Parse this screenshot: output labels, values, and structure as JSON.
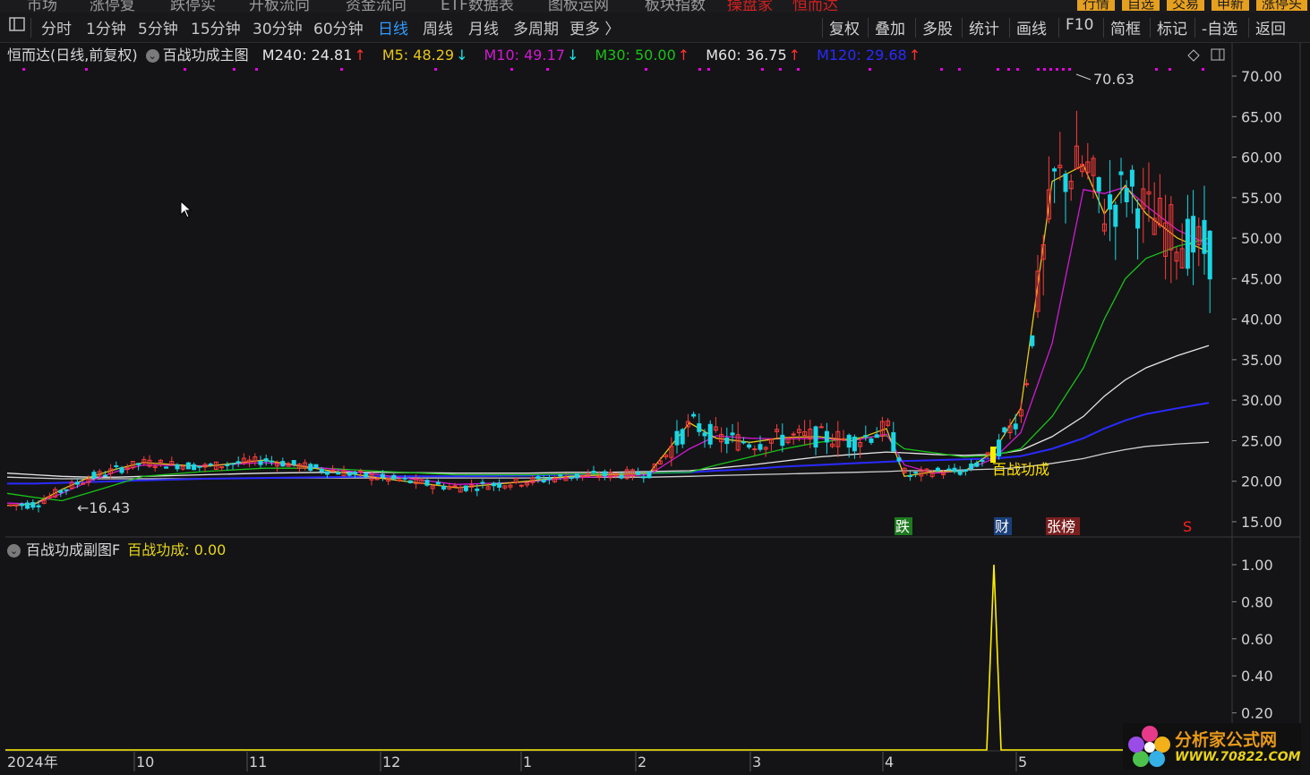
{
  "top_menu": {
    "items": [
      "市场",
      "涨停复",
      "跌停实",
      "开板流向",
      "资金流向",
      "ETF数据表",
      "图板运网",
      "板块指数"
    ],
    "red_items": [
      "操盘家",
      "恒而达"
    ],
    "right_tags": [
      {
        "label": "行情",
        "color": "#e6a020"
      },
      {
        "label": "自选",
        "color": "#e6a020"
      },
      {
        "label": "交易",
        "color": "#e6a020"
      },
      {
        "label": "申新",
        "color": "#e6a020"
      },
      {
        "label": "涨停头",
        "color": "#e6a020"
      }
    ]
  },
  "toolbar": {
    "periods": [
      "分时",
      "1分钟",
      "5分钟",
      "15分钟",
      "30分钟",
      "60分钟",
      "日线",
      "周线",
      "月线",
      "多周期",
      "更多 〉"
    ],
    "active_period": "日线",
    "right_buttons": [
      "复权",
      "叠加",
      "多股",
      "统计",
      "画线",
      "F10",
      "简框",
      "标记",
      "-自选",
      "返回"
    ]
  },
  "main_legend": {
    "title": "恒而达(日线,前复权)",
    "indicator_name": "百战功成主图",
    "ma_items": [
      {
        "label": "M240: 24.81",
        "arrow": "↑",
        "color": "#e6e6e6",
        "arrow_color": "#ff3030"
      },
      {
        "label": "M5: 48.29",
        "arrow": "↓",
        "color": "#e6c619",
        "arrow_color": "#19e6e6"
      },
      {
        "label": "M10: 49.17",
        "arrow": "↓",
        "color": "#d219d2",
        "arrow_color": "#19e6e6"
      },
      {
        "label": "M30: 50.00",
        "arrow": "↑",
        "color": "#19c219",
        "arrow_color": "#ff3030"
      },
      {
        "label": "M60: 36.75",
        "arrow": "↑",
        "color": "#e6e6e6",
        "arrow_color": "#ff3030"
      },
      {
        "label": "M120: 29.68",
        "arrow": "↑",
        "color": "#2a2aff",
        "arrow_color": "#ff3030"
      }
    ]
  },
  "sub_legend": {
    "indicator_name": "百战功成副图F",
    "value_label": "百战功成: 0.00",
    "value_color": "#e6d619"
  },
  "y_axis_main": [
    "70.00",
    "65.00",
    "60.00",
    "55.00",
    "50.00",
    "45.00",
    "40.00",
    "35.00",
    "30.00",
    "25.00",
    "20.00",
    "15.00"
  ],
  "y_axis_sub": [
    "1.00",
    "0.80",
    "0.60",
    "0.40",
    "0.20"
  ],
  "x_axis": [
    "2024年",
    "10",
    "11",
    "12",
    "1",
    "2",
    "3",
    "4",
    "5"
  ],
  "annotations": {
    "high_label": "70.63",
    "low_label": "16.43",
    "signal_text": "百战功成",
    "markers": [
      {
        "text": "跌",
        "bg": "#1f7a1f",
        "color": "#ffffff"
      },
      {
        "text": "财",
        "bg": "#1a3f7a",
        "color": "#ffffff"
      },
      {
        "text": "张榜",
        "bg": "#7a1f1f",
        "color": "#ffffff"
      },
      {
        "text": "S",
        "bg": "",
        "color": "#ff2020"
      }
    ]
  },
  "watermark": {
    "line1": "分析家公式网",
    "line2": "WWW.70822.COM"
  },
  "chart_data": {
    "type": "line",
    "title": "",
    "x_ticks": [
      "2024年",
      "10",
      "11",
      "12",
      "1",
      "2",
      "3",
      "4",
      "5"
    ],
    "ylim_main": [
      15,
      72
    ],
    "ylim_sub": [
      0,
      1.05
    ],
    "series": [
      {
        "name": "M5",
        "color": "#e6c619",
        "values": [
          17.0,
          17.2,
          19.0,
          20.5,
          21.5,
          22.3,
          21.8,
          22.6,
          21.4,
          20.3,
          19.2,
          20.0,
          20.6,
          20.8,
          21.0,
          27.2,
          25.3,
          24.8,
          25.4,
          25.5,
          25.0,
          26.5,
          20.6,
          21.2,
          21.2,
          23.7,
          29.0,
          57.0,
          59.0,
          53.0,
          56.5,
          53.0,
          50.0,
          48.3
        ]
      },
      {
        "name": "M10",
        "color": "#d219d2",
        "values": [
          17.3,
          17.2,
          18.5,
          20.0,
          21.2,
          22.0,
          21.9,
          22.3,
          21.6,
          20.7,
          19.6,
          19.9,
          20.4,
          20.6,
          20.8,
          24.0,
          25.6,
          25.3,
          25.2,
          25.3,
          25.0,
          25.8,
          22.0,
          21.0,
          21.3,
          22.8,
          26.0,
          37.0,
          56.0,
          55.5,
          56.3,
          54.0,
          51.0,
          49.2
        ]
      },
      {
        "name": "M30",
        "color": "#19c219",
        "values": [
          18.5,
          18.0,
          17.6,
          18.6,
          19.6,
          20.6,
          21.2,
          21.6,
          21.6,
          21.2,
          20.8,
          20.8,
          20.9,
          20.9,
          21.0,
          21.1,
          22.0,
          23.0,
          24.0,
          24.8,
          25.3,
          25.6,
          24.0,
          23.5,
          23.0,
          23.2,
          24.0,
          28.0,
          34.0,
          40.0,
          45.0,
          47.5,
          49.0,
          50.0
        ]
      },
      {
        "name": "M60",
        "color": "#e6e6e6",
        "values": [
          21.0,
          20.8,
          20.6,
          20.5,
          20.5,
          20.6,
          20.8,
          21.0,
          21.1,
          21.1,
          21.0,
          21.0,
          21.1,
          21.1,
          21.2,
          21.3,
          21.6,
          22.0,
          22.5,
          23.0,
          23.3,
          23.6,
          23.5,
          23.3,
          23.2,
          23.3,
          23.8,
          25.5,
          28.0,
          30.5,
          32.5,
          34.0,
          35.5,
          36.75
        ]
      },
      {
        "name": "M120",
        "color": "#2a2aff",
        "values": [
          19.7,
          19.7,
          19.8,
          19.9,
          20.0,
          20.1,
          20.3,
          20.4,
          20.5,
          20.6,
          20.6,
          20.7,
          20.8,
          20.9,
          21.0,
          21.1,
          21.3,
          21.5,
          21.8,
          22.0,
          22.2,
          22.4,
          22.5,
          22.6,
          22.7,
          22.8,
          23.1,
          24.0,
          25.3,
          26.5,
          27.5,
          28.3,
          29.0,
          29.68
        ]
      },
      {
        "name": "M240",
        "color": "#d0d0d0",
        "values": [
          20.5,
          20.4,
          20.3,
          20.3,
          20.3,
          20.3,
          20.3,
          20.4,
          20.4,
          20.4,
          20.4,
          20.4,
          20.5,
          20.5,
          20.5,
          20.6,
          20.7,
          20.8,
          20.9,
          21.0,
          21.1,
          21.2,
          21.3,
          21.3,
          21.4,
          21.5,
          21.7,
          22.2,
          22.8,
          23.4,
          23.9,
          24.3,
          24.6,
          24.81
        ]
      }
    ],
    "sub_series": {
      "name": "百战功成",
      "values": [
        0,
        0,
        0,
        0,
        0,
        0,
        0,
        0,
        0,
        0,
        0,
        0,
        0,
        0,
        0,
        0,
        0,
        0,
        0,
        0,
        0,
        0,
        0,
        0,
        0,
        1.0,
        0,
        0,
        0,
        0,
        0,
        0,
        0,
        0
      ]
    }
  }
}
